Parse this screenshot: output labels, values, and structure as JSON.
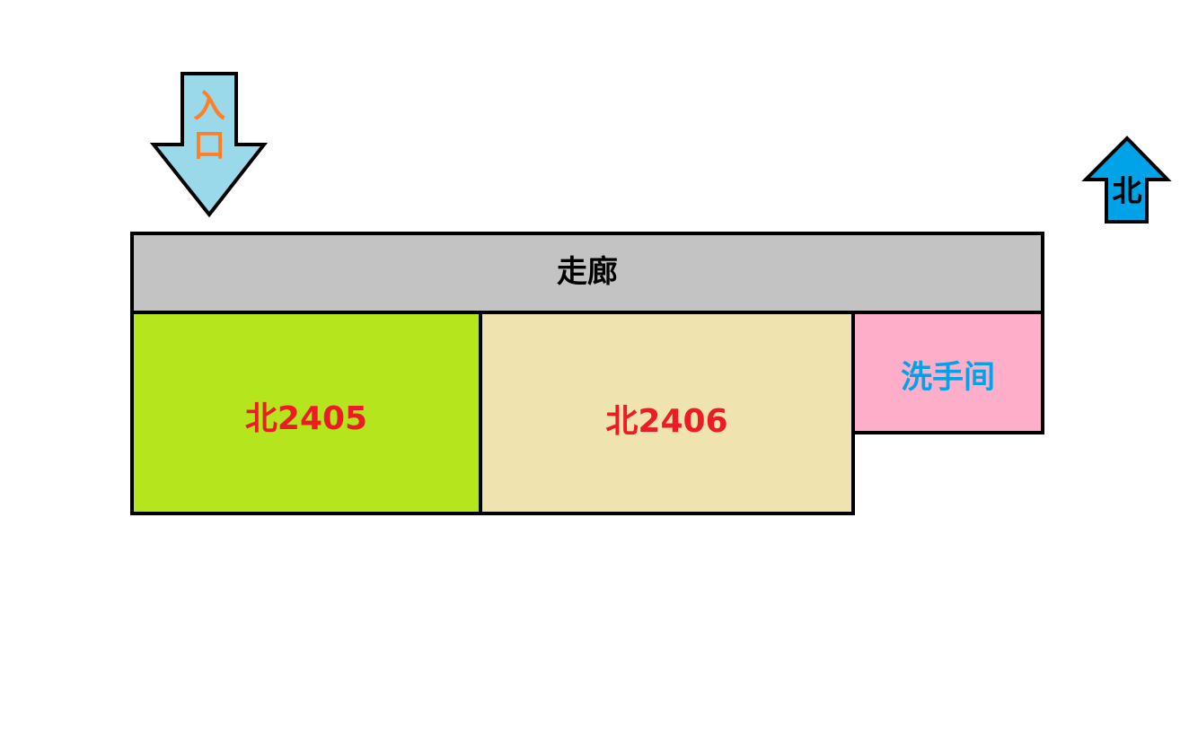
{
  "diagram": {
    "entrance": {
      "label_line1": "入",
      "label_line2": "口"
    },
    "north_marker": {
      "label": "北"
    },
    "corridor": {
      "label": "走廊"
    },
    "rooms": [
      {
        "label": "北2405"
      },
      {
        "label": "北2406"
      },
      {
        "label": "洗手间"
      }
    ]
  },
  "colors": {
    "corridor_fill": "#c3c3c3",
    "room_2405_fill": "#b5e61d",
    "room_2406_fill": "#efe4b0",
    "restroom_fill": "#ffaec9",
    "entrance_arrow_fill": "#99d9ea",
    "north_arrow_fill": "#00a2e8",
    "room_label_color": "#ed1c24",
    "restroom_label_color": "#00a2e8",
    "entrance_label_color": "#ff7f27",
    "corridor_label_color": "#000000",
    "north_label_color": "#000000",
    "outline": "#000000"
  }
}
